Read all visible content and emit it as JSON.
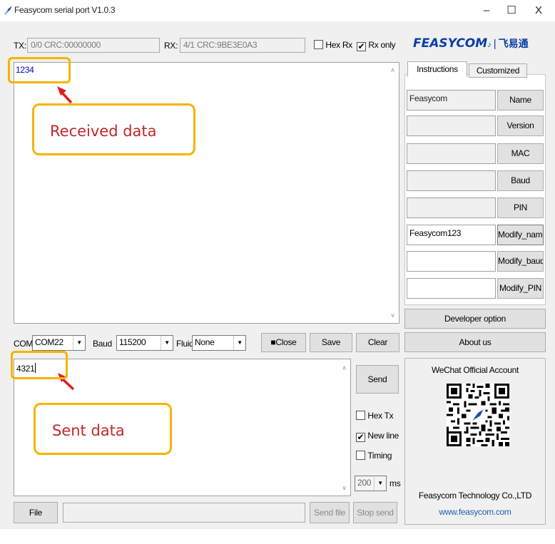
{
  "window": {
    "title": "Feasycom serial port V1.0.3",
    "minimize": "–",
    "maximize": "☐",
    "close": "X"
  },
  "top_bar": {
    "tx_label": "TX:",
    "tx_value": "0/0 CRC:00000000",
    "rx_label": "RX:",
    "rx_value": "4/1 CRC:9BE3E0A3",
    "hex_rx_label": "Hex Rx",
    "hex_rx_checked": false,
    "rx_only_label": "Rx only",
    "rx_only_checked": true
  },
  "logo": {
    "text": "FEASYCOM",
    "symbol": "♪",
    "separator": "|",
    "chinese": "飞易通",
    "color": "#0a3ea8"
  },
  "receive": {
    "text": "1234",
    "text_color": "#0000cc"
  },
  "serial_config": {
    "com_label": "COM",
    "com_value": "COM22",
    "baud_label": "Baud",
    "baud_value": "115200",
    "fluid_label": "Fluid",
    "fluid_value": "None",
    "close_label": "■Close",
    "save_label": "Save",
    "clear_label": "Clear"
  },
  "send": {
    "text": "4321",
    "send_label": "Send",
    "hex_tx_label": "Hex Tx",
    "hex_tx_checked": false,
    "new_line_label": "New line",
    "new_line_checked": true,
    "timing_label": "Timing",
    "timing_checked": false,
    "interval_value": "200",
    "interval_unit": "ms"
  },
  "bottom_bar": {
    "file_label": "File",
    "file_path": "",
    "send_file_label": "Send file",
    "stop_send_label": "Stop send"
  },
  "right_panel": {
    "tabs": [
      {
        "label": "Instructions",
        "active": true
      },
      {
        "label": "Customized",
        "active": false
      }
    ],
    "commands": [
      {
        "value": "Feasycom",
        "button": "Name",
        "disabled": true
      },
      {
        "value": "",
        "button": "Version",
        "disabled": true
      },
      {
        "value": "",
        "button": "MAC",
        "disabled": true
      },
      {
        "value": "",
        "button": "Baud",
        "disabled": true
      },
      {
        "value": "",
        "button": "PIN",
        "disabled": true
      },
      {
        "value": "Feasycom123",
        "button": "Modify_name",
        "disabled": false
      },
      {
        "value": "",
        "button": "Modify_baud",
        "disabled": false
      },
      {
        "value": "",
        "button": "Modify_PIN",
        "disabled": false
      }
    ],
    "developer_label": "Developer option",
    "about_label": "About us",
    "wechat_title": "WeChat Official Account",
    "company": "Feasycom Technology Co.,LTD",
    "website": "www.feasycom.com",
    "website_color": "#1a5fb4"
  },
  "annotations": {
    "received": "Received data",
    "sent": "Sent data",
    "color": "#c0282c",
    "border_color": "#f5b400"
  }
}
